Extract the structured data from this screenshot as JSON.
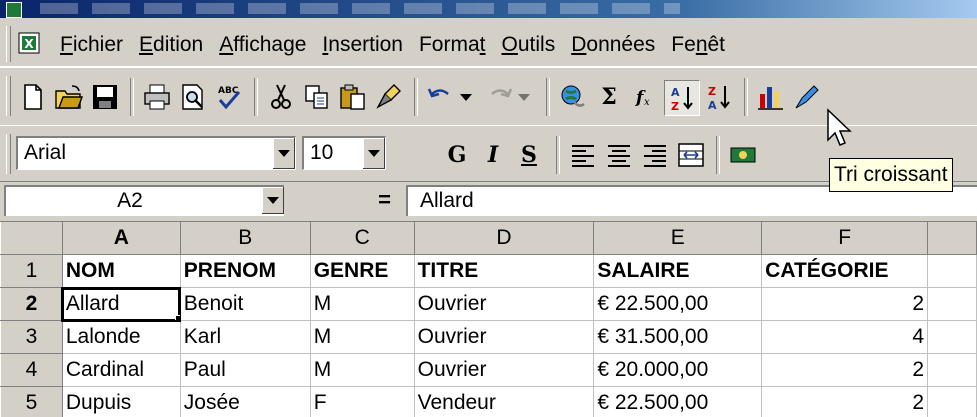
{
  "menubar": {
    "items": [
      {
        "pre": "",
        "u": "F",
        "post": "ichier"
      },
      {
        "pre": "",
        "u": "E",
        "post": "dition"
      },
      {
        "pre": "",
        "u": "A",
        "post": "ffichage"
      },
      {
        "pre": "",
        "u": "I",
        "post": "nsertion"
      },
      {
        "pre": "Forma",
        "u": "t",
        "post": ""
      },
      {
        "pre": "",
        "u": "O",
        "post": "utils"
      },
      {
        "pre": "",
        "u": "D",
        "post": "onnées"
      },
      {
        "pre": "Fe",
        "u": "n",
        "post": "êt"
      }
    ]
  },
  "toolbar_format": {
    "font_name": "Arial",
    "font_size": "10",
    "bold_label": "G",
    "italic_label": "I",
    "underline_label": "S"
  },
  "tooltip": "Tri croissant",
  "formula_bar": {
    "name_box": "A2",
    "equals": "=",
    "content": "Allard"
  },
  "sheet": {
    "columns": [
      "A",
      "B",
      "C",
      "D",
      "E",
      "F"
    ],
    "rows": [
      {
        "num": "1",
        "cells": [
          "NOM",
          "PRENOM",
          "GENRE",
          "TITRE",
          "SALAIRE",
          "CATÉGORIE"
        ]
      },
      {
        "num": "2",
        "cells": [
          "Allard",
          "Benoit",
          "M",
          "Ouvrier",
          "€ 22.500,00",
          "2"
        ]
      },
      {
        "num": "3",
        "cells": [
          "Lalonde",
          "Karl",
          "M",
          "Ouvrier",
          "€ 31.500,00",
          "4"
        ]
      },
      {
        "num": "4",
        "cells": [
          "Cardinal",
          "Paul",
          "M",
          "Ouvrier",
          "€ 20.000,00",
          "2"
        ]
      },
      {
        "num": "5",
        "cells": [
          "Dupuis",
          "Josée",
          "F",
          "Vendeur",
          "€ 22.500,00",
          "2"
        ]
      }
    ]
  }
}
